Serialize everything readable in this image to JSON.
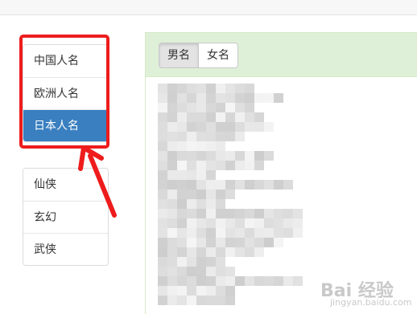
{
  "nav": {
    "names": [
      {
        "label": "中国人名",
        "active": false
      },
      {
        "label": "欧洲人名",
        "active": false
      },
      {
        "label": "日本人名",
        "active": true
      }
    ],
    "genres": [
      {
        "label": "仙侠"
      },
      {
        "label": "玄幻"
      },
      {
        "label": "武侠"
      }
    ]
  },
  "gender_tabs": {
    "male": "男名",
    "female": "女名"
  },
  "colors": {
    "active": "#3a7fc0",
    "annotation": "#ee1c1c",
    "panel_heading": "#dff0d8"
  },
  "watermark": {
    "text": "Bai 经验",
    "sub": "jingyan.baidu.com"
  }
}
